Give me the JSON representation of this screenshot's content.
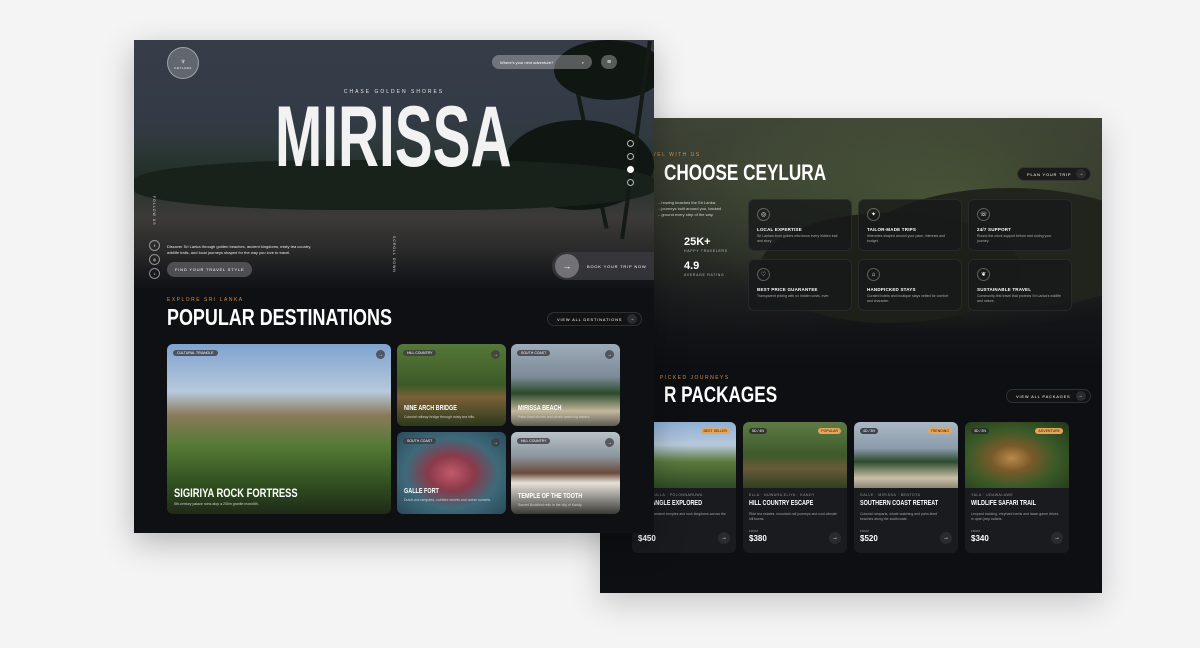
{
  "back": {
    "eyebrow": "AVEL WITH US",
    "title": "CHOOSE CEYLURA",
    "desc": "...howing beaches the Sri Lanka. ...journeys built around you, backed ...ground every step of the way.",
    "plan_btn": "PLAN YOUR TRIP",
    "stats": [
      {
        "n": "25K+",
        "l": "HAPPY TRAVELERS"
      },
      {
        "n": "4.9",
        "l": "AVERAGE RATING"
      }
    ],
    "features": [
      {
        "icon": "◎",
        "title": "LOCAL EXPERTISE",
        "desc": "Sri Lankan-born guides who know every hidden trail and story."
      },
      {
        "icon": "✦",
        "title": "TAILOR-MADE TRIPS",
        "desc": "Itineraries shaped around your pace, interests and budget."
      },
      {
        "icon": "☏",
        "title": "24/7 SUPPORT",
        "desc": "Round-the-clock support before and during your journey."
      },
      {
        "icon": "♡",
        "title": "BEST PRICE GUARANTEE",
        "desc": "Transparent pricing with no hidden costs, ever."
      },
      {
        "icon": "⌂",
        "title": "HANDPICKED STAYS",
        "desc": "Curated hotels and boutique stays vetted for comfort and character."
      },
      {
        "icon": "❦",
        "title": "SUSTAINABLE TRAVEL",
        "desc": "Community-first travel that protects Sri Lanka's wildlife and nature."
      }
    ],
    "eyebrow2": "PICKED JOURNEYS",
    "title2": "R PACKAGES",
    "packages_btn": "VIEW ALL PACKAGES",
    "packages": [
      {
        "tag": "",
        "badge": "BEST SELLER",
        "loc": "...DAMBULLA · POLONNARUWA",
        "title": "...TRIANGLE EXPLORED",
        "desc": "...Lanka's ancient temples and rock kingdoms across the heartland.",
        "from": "",
        "price": "$450"
      },
      {
        "tag": "5D / 4N",
        "badge": "POPULAR",
        "loc": "ELLA · NUWARA ELIYA · KANDY",
        "title": "HILL COUNTRY ESCAPE",
        "desc": "Ride tea estates, mountain rail journeys and cool-climate hill towns.",
        "from": "FROM",
        "price": "$380"
      },
      {
        "tag": "4D / 3N",
        "badge": "TRENDING",
        "loc": "GALLE · MIRISSA · BENTOTA",
        "title": "SOUTHERN COAST RETREAT",
        "desc": "Colonial ramparts, whale watching and palm-lined beaches along the southcoast.",
        "from": "FROM",
        "price": "$520"
      },
      {
        "tag": "3D / 2N",
        "badge": "ADVENTURE",
        "loc": "YALA · UDAWALAWE",
        "title": "WILDLIFE SAFARI TRAIL",
        "desc": "Leopard tracking, elephant herds and dawn game drives in open jeep safaris.",
        "from": "FROM",
        "price": "$340"
      }
    ]
  },
  "front": {
    "logo": "CEYLURA",
    "search_placeholder": "Where's your next adventure?",
    "subtitle": "CHASE GOLDEN SHORES",
    "title": "MIRISSA",
    "side_vertical": "FOLLOW US",
    "scroll_vertical": "SCROLL DOWN",
    "intro": "Discover Sri Lanka through golden beaches, ancient kingdoms, misty tea country, wildlife trails, and local journeys shaped for the way you love to travel.",
    "cta_style": "FIND YOUR TRAVEL STYLE",
    "cta_plan": "BOOK YOUR TRIP NOW",
    "eyebrow": "EXPLORE SRI LANKA",
    "section_title": "POPULAR DESTINATIONS",
    "view_all": "VIEW ALL DESTINATIONS",
    "destinations": [
      {
        "tag": "CULTURAL TRIANGLE",
        "title": "SIGIRIYA ROCK FORTRESS",
        "desc": "5th-century palace ruins atop a 200m granite monolith."
      },
      {
        "tag": "HILL COUNTRY",
        "title": "NINE ARCH BRIDGE",
        "desc": "Colonial railway bridge through misty tea hills."
      },
      {
        "tag": "SOUTH COAST",
        "title": "MIRISSA BEACH",
        "desc": "Palm-lined shores and whale-watching waters."
      },
      {
        "tag": "SOUTH COAST",
        "title": "GALLE FORT",
        "desc": "Dutch-era ramparts, cobbled streets and ocean sunsets."
      },
      {
        "tag": "HILL COUNTRY",
        "title": "TEMPLE OF THE TOOTH",
        "desc": "Sacred Buddhist relic in the city of Kandy."
      }
    ]
  }
}
